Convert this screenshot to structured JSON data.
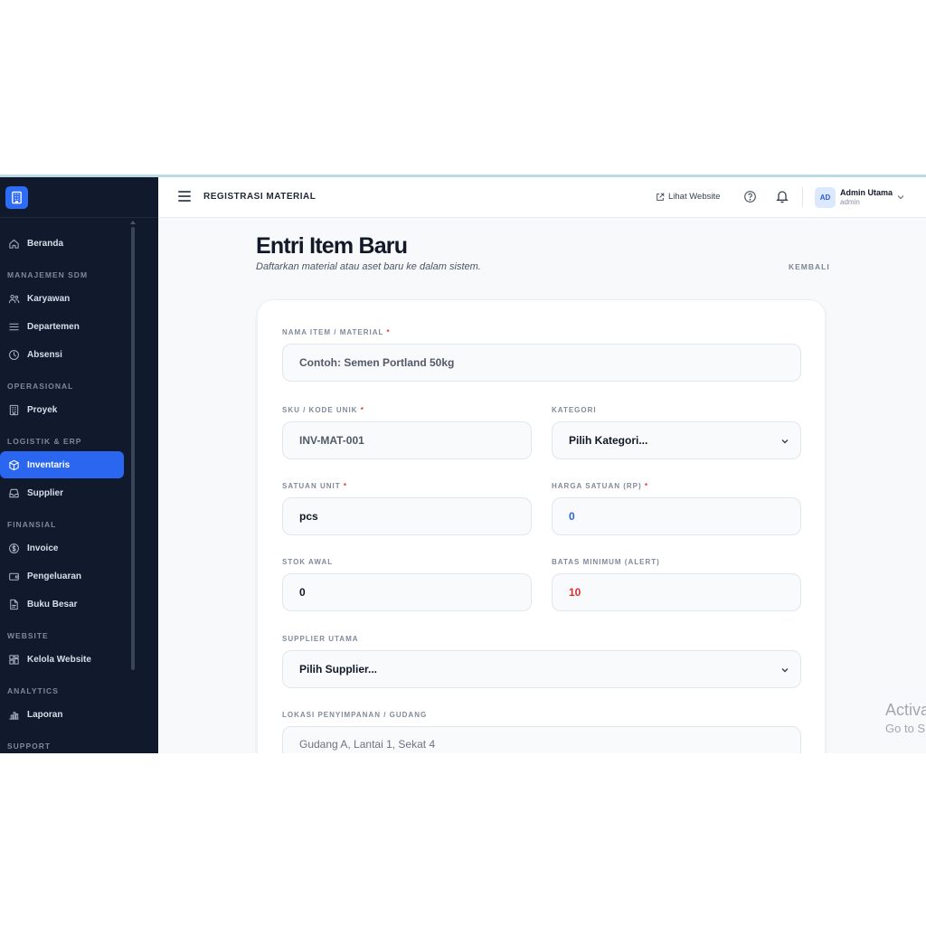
{
  "sidebar": {
    "items": [
      {
        "type": "item",
        "label": "Beranda",
        "icon": "home-icon"
      },
      {
        "type": "section",
        "label": "MANAJEMEN SDM"
      },
      {
        "type": "item",
        "label": "Karyawan",
        "icon": "users-icon"
      },
      {
        "type": "item",
        "label": "Departemen",
        "icon": "list-icon"
      },
      {
        "type": "item",
        "label": "Absensi",
        "icon": "clock-icon"
      },
      {
        "type": "section",
        "label": "OPERASIONAL"
      },
      {
        "type": "item",
        "label": "Proyek",
        "icon": "building-icon"
      },
      {
        "type": "section",
        "label": "LOGISTIK & ERP"
      },
      {
        "type": "item",
        "label": "Inventaris",
        "icon": "box-icon",
        "active": true
      },
      {
        "type": "item",
        "label": "Supplier",
        "icon": "inbox-icon"
      },
      {
        "type": "section",
        "label": "FINANSIAL"
      },
      {
        "type": "item",
        "label": "Invoice",
        "icon": "dollar-icon"
      },
      {
        "type": "item",
        "label": "Pengeluaran",
        "icon": "wallet-icon"
      },
      {
        "type": "item",
        "label": "Buku Besar",
        "icon": "file-icon"
      },
      {
        "type": "section",
        "label": "WEBSITE"
      },
      {
        "type": "item",
        "label": "Kelola Website",
        "icon": "layout-icon"
      },
      {
        "type": "section",
        "label": "ANALYTICS"
      },
      {
        "type": "item",
        "label": "Laporan",
        "icon": "bar-chart-icon"
      },
      {
        "type": "section",
        "label": "SUPPORT"
      }
    ]
  },
  "header": {
    "title": "REGISTRASI MATERIAL",
    "lihat_website": "Lihat Website",
    "avatar_initials": "AD",
    "user_name": "Admin Utama",
    "user_role": "admin"
  },
  "main": {
    "title": "Entri Item Baru",
    "subtitle": "Daftarkan material atau aset baru ke dalam sistem.",
    "back": "KEMBALI"
  },
  "form": {
    "nama": {
      "label": "NAMA ITEM / MATERIAL",
      "required": "*",
      "placeholder": "Contoh: Semen Portland 50kg"
    },
    "sku": {
      "label": "SKU / KODE UNIK",
      "required": "*",
      "placeholder": "INV-MAT-001"
    },
    "kategori": {
      "label": "KATEGORI",
      "value": "Pilih Kategori..."
    },
    "satuan": {
      "label": "SATUAN UNIT",
      "required": "*",
      "value": "pcs"
    },
    "harga": {
      "label": "HARGA SATUAN (RP)",
      "required": "*",
      "value": "0"
    },
    "stok": {
      "label": "STOK AWAL",
      "value": "0"
    },
    "batas": {
      "label": "BATAS MINIMUM (ALERT)",
      "value": "10"
    },
    "supplier": {
      "label": "SUPPLIER UTAMA",
      "value": "Pilih Supplier..."
    },
    "lokasi": {
      "label": "LOKASI PENYIMPANAN / GUDANG",
      "placeholder": "Gudang A, Lantai 1, Sekat 4"
    }
  },
  "watermark": {
    "line1": "Activa",
    "line2": "Go to S"
  },
  "colors": {
    "sidebar_bg": "#101a2c",
    "accent": "#2a66f0",
    "value_blue": "#2f62d8",
    "value_red": "#d92d2d"
  }
}
